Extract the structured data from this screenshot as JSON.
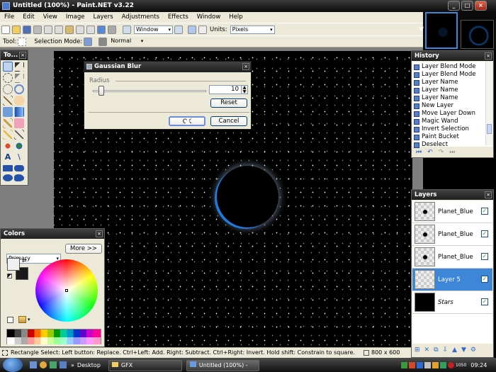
{
  "window": {
    "title": "Untitled (100%) - Paint.NET v3.22",
    "min": "_",
    "max": "□",
    "close": "×"
  },
  "menu": [
    "File",
    "Edit",
    "View",
    "Image",
    "Layers",
    "Adjustments",
    "Effects",
    "Window",
    "Help"
  ],
  "toolbar": {
    "zoom_value": "Window",
    "units_label": "Units:",
    "units_value": "Pixels"
  },
  "toolbar2": {
    "tool_label": "Tool:",
    "selection_mode_label": "Selection Mode:",
    "blend_value": "Normal"
  },
  "tools_panel": {
    "title": "To..."
  },
  "dialog": {
    "title": "Gaussian Blur",
    "radius_label": "Radius",
    "radius_value": "10",
    "radius_fraction": 0.05,
    "reset": "Reset",
    "ok": "OK",
    "cancel": "Cancel"
  },
  "history": {
    "title": "History",
    "items": [
      "Layer Blend Mode",
      "Layer Blend Mode",
      "Layer Name",
      "Layer Name",
      "Layer Name",
      "New Layer",
      "Move Layer Down",
      "Magic Wand",
      "Invert Selection",
      "Paint Bucket",
      "Deselect"
    ]
  },
  "layers": {
    "title": "Layers",
    "items": [
      {
        "name": "Planet_Blue",
        "selected": false,
        "checked": true
      },
      {
        "name": "Planet_Blue",
        "selected": false,
        "checked": true
      },
      {
        "name": "Planet_Blue",
        "selected": false,
        "checked": true
      },
      {
        "name": "Layer 5",
        "selected": true,
        "checked": true
      },
      {
        "name": "Stars",
        "selected": false,
        "checked": true
      }
    ]
  },
  "colors": {
    "title": "Colors",
    "mode": "Primary",
    "more_button": "More >>",
    "primary": "#000000",
    "secondary": "#ffffff"
  },
  "status": {
    "text": "Rectangle Select: Left button: Replace. Ctrl+Left: Add. Right: Subtract. Ctrl+Right: Invert. Hold shift: Constrain to square.",
    "size": "800 x 600"
  },
  "taskbar": {
    "desktop": "Desktop",
    "gfx": "GFX",
    "paint": "Untitled (100%) - Pain...",
    "clock": "09:24",
    "tray_text": "1050"
  },
  "accent": {
    "selection": "#3e86d8",
    "planet_rim": "#2e8ee8"
  }
}
